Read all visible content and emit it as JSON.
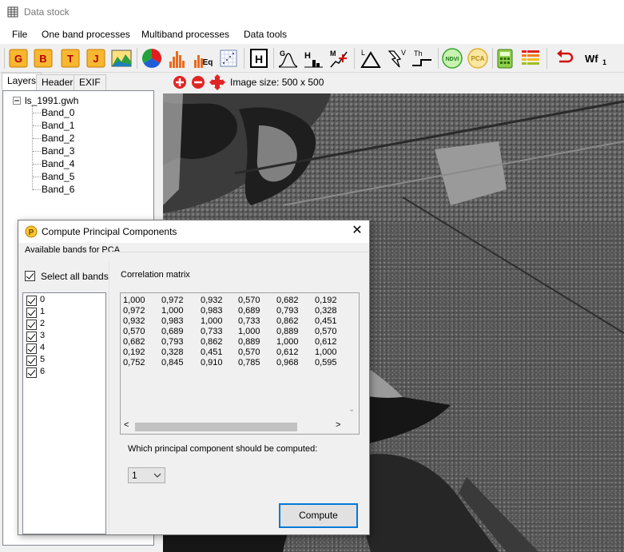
{
  "window": {
    "title": "Data stock"
  },
  "menu": [
    "File",
    "One band processes",
    "Multiband processes",
    "Data tools"
  ],
  "toolbar": {
    "letters": [
      "G",
      "B",
      "T",
      "J"
    ],
    "labels": {
      "eq": "Eq",
      "h": "H",
      "g": "G",
      "m": "M",
      "l": "L",
      "v": "V",
      "th": "Th",
      "ndvi": "NDVI",
      "pca": "PCA",
      "wf": "Wf",
      "wf_sub": "1"
    },
    "icons": [
      "green-band-icon",
      "blue-band-icon",
      "thermal-band-icon",
      "jpeg-icon",
      "landscape-icon",
      "rgb-pie-icon",
      "histogram-icon",
      "equalize-icon",
      "scatter-icon",
      "header-icon",
      "gaussian-icon",
      "histogram-h-icon",
      "median-filter-icon",
      "laplace-icon",
      "sobel-icon",
      "threshold-icon",
      "ndvi-icon",
      "pca-icon",
      "calculator-icon",
      "legend-icon",
      "undo-icon",
      "wf-icon"
    ]
  },
  "sidebar": {
    "tabs": [
      "Layers",
      "Header",
      "EXIF"
    ],
    "tree": {
      "root": "ls_1991.gwh",
      "bands": [
        "Band_0",
        "Band_1",
        "Band_2",
        "Band_3",
        "Band_4",
        "Band_5",
        "Band_6"
      ]
    }
  },
  "image": {
    "size_label": "Image size: 500 x 500"
  },
  "dialog": {
    "title": "Compute Principal Components",
    "group_label": "Available bands for PCA",
    "select_all_label": "Select all bands",
    "select_all_checked": true,
    "bands": [
      {
        "label": "0",
        "checked": true
      },
      {
        "label": "1",
        "checked": true
      },
      {
        "label": "2",
        "checked": true
      },
      {
        "label": "3",
        "checked": true
      },
      {
        "label": "4",
        "checked": true
      },
      {
        "label": "5",
        "checked": true
      },
      {
        "label": "6",
        "checked": true
      }
    ],
    "matrix_label": "Correlation matrix",
    "matrix": [
      [
        "1,000",
        "0,972",
        "0,932",
        "0,570",
        "0,682",
        "0,192"
      ],
      [
        "0,972",
        "1,000",
        "0,983",
        "0,689",
        "0,793",
        "0,328"
      ],
      [
        "0,932",
        "0,983",
        "1,000",
        "0,733",
        "0,862",
        "0,451"
      ],
      [
        "0,570",
        "0,689",
        "0,733",
        "1,000",
        "0,889",
        "0,570"
      ],
      [
        "0,682",
        "0,793",
        "0,862",
        "0,889",
        "1,000",
        "0,612"
      ],
      [
        "0,192",
        "0,328",
        "0,451",
        "0,570",
        "0,612",
        "1,000"
      ],
      [
        "0,752",
        "0,845",
        "0,910",
        "0,785",
        "0,968",
        "0,595"
      ]
    ],
    "question": "Which principal component should be computed:",
    "component_selected": "1",
    "compute_label": "Compute"
  },
  "colors": {
    "accent": "#0078d7",
    "window_bg": "#f0f0f0"
  }
}
